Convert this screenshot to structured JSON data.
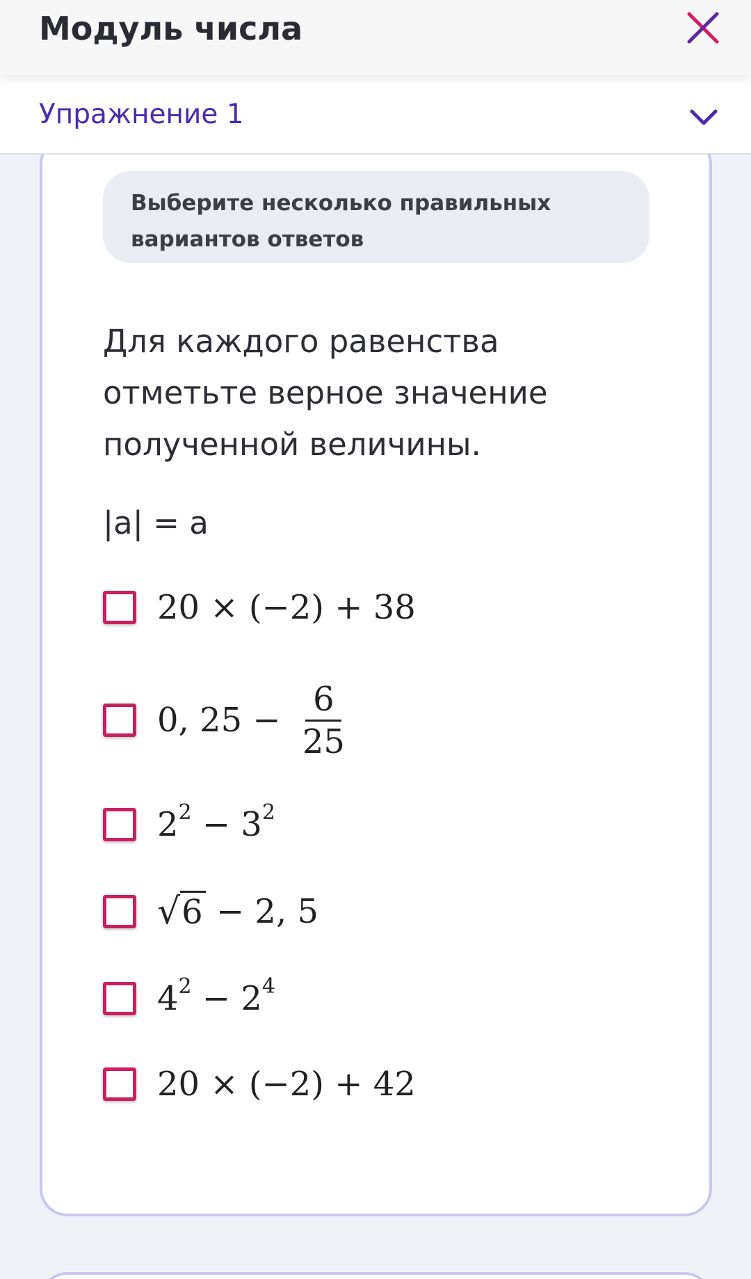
{
  "header": {
    "title": "Модуль числа",
    "close_icon": "close-icon",
    "close_color": "#d81b60"
  },
  "exercise": {
    "label": "Упражнение 1",
    "chevron_icon": "chevron-down-icon",
    "accent": "#4a2bb0"
  },
  "task": {
    "instruction_line1": "Выберите несколько правильных",
    "instruction_line2": "вариантов ответов",
    "question": "Для каждого равенства отметьте верное значение полученной величины.",
    "equation": "|a| = a"
  },
  "options": [
    {
      "text": "20 × (−2) + 38",
      "checked": false
    },
    {
      "pre": "0, 25 − ",
      "num": "6",
      "den": "25",
      "checked": false
    },
    {
      "a": "2",
      "a_exp": "2",
      "op": " − ",
      "b": "3",
      "b_exp": "2",
      "checked": false
    },
    {
      "radicand": "6",
      "rest": " − 2, 5",
      "checked": false
    },
    {
      "a": "4",
      "a_exp": "2",
      "op": " − ",
      "b": "2",
      "b_exp": "4",
      "checked": false
    },
    {
      "text": "20 × (−2) + 42",
      "checked": false
    }
  ],
  "colors": {
    "checkbox_border": "#cc1f5f",
    "card_border": "#c9c6ef",
    "background": "#eef2f7"
  }
}
